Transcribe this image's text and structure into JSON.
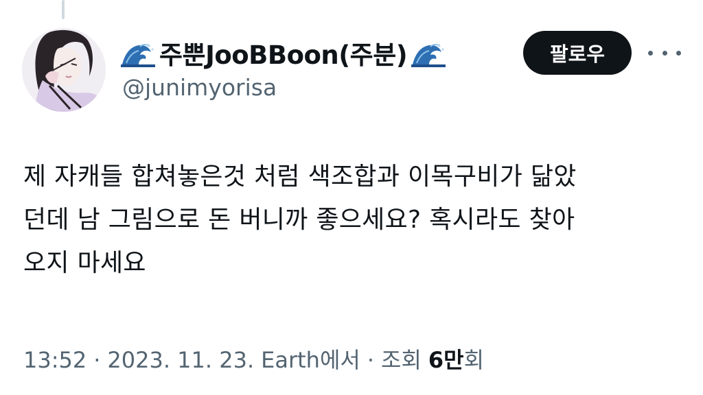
{
  "author": {
    "display_name": "주뿐JooBBoon(주분)",
    "handle": "@junimyorisa",
    "name_icon": "water-wave-emoji"
  },
  "actions": {
    "follow_label": "팔로우",
    "more_icon": "more-horizontal-icon"
  },
  "tweet": {
    "text": "제 자캐들 합쳐놓은것 처럼 색조합과 이목구비가 닮았\n던데 남 그림으로 돈 버니까 좋으세요? 혹시라도 찾아\n오지 마세요"
  },
  "meta": {
    "time": "13:52",
    "separator": "·",
    "date": "2023. 11. 23.",
    "source": "Earth에서",
    "views_label": "조회",
    "views_count": "6만",
    "views_suffix": "회"
  },
  "colors": {
    "text": "#0f1419",
    "secondary": "#536471",
    "button_bg": "#0f1419",
    "button_text": "#ffffff",
    "thread_line": "#cfd9de"
  }
}
